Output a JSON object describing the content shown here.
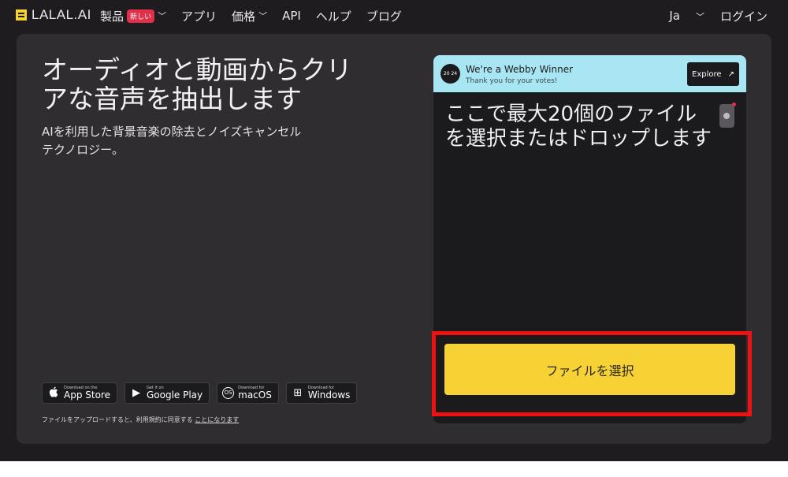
{
  "header": {
    "logo": "LALAL.AI",
    "nav": [
      {
        "label": "製品",
        "badge": "新しい",
        "chevron": true
      },
      {
        "label": "アプリ",
        "chevron": false
      },
      {
        "label": "価格",
        "chevron": true
      },
      {
        "label": "API",
        "chevron": false
      },
      {
        "label": "ヘルプ",
        "chevron": false
      },
      {
        "label": "ブログ",
        "chevron": false
      }
    ],
    "language": "Ja",
    "login": "ログイン"
  },
  "hero": {
    "title": "オーディオと動画からクリアな音声を抽出します",
    "subtitle": "AIを利用した背景音楽の除去とノイズキャンセルテクノロジー。"
  },
  "stores": [
    {
      "small": "Download on the",
      "big": "App Store",
      "icon": "apple-icon",
      "glyph": ""
    },
    {
      "small": "Get it on",
      "big": "Google Play",
      "icon": "play-icon",
      "glyph": "▶"
    },
    {
      "small": "Download for",
      "big": "macOS",
      "icon": "macos-icon",
      "glyph": "OS"
    },
    {
      "small": "Download for",
      "big": "Windows",
      "icon": "windows-icon",
      "glyph": "⊞"
    }
  ],
  "legal": {
    "text": "ファイルをアップロードすると、利用規約に同意する",
    "link": "ことになります"
  },
  "webby": {
    "title": "We're a Webby Winner",
    "subtitle": "Thank you for your votes!",
    "button": "Explore",
    "badge_text": "20 24"
  },
  "upload": {
    "drop_text": "ここで最大20個のファイルを選択またはドロップします",
    "button": "ファイルを選択"
  },
  "colors": {
    "accent": "#f7d234",
    "highlight": "#ee1111",
    "webby_bg": "#a7e6f2"
  }
}
